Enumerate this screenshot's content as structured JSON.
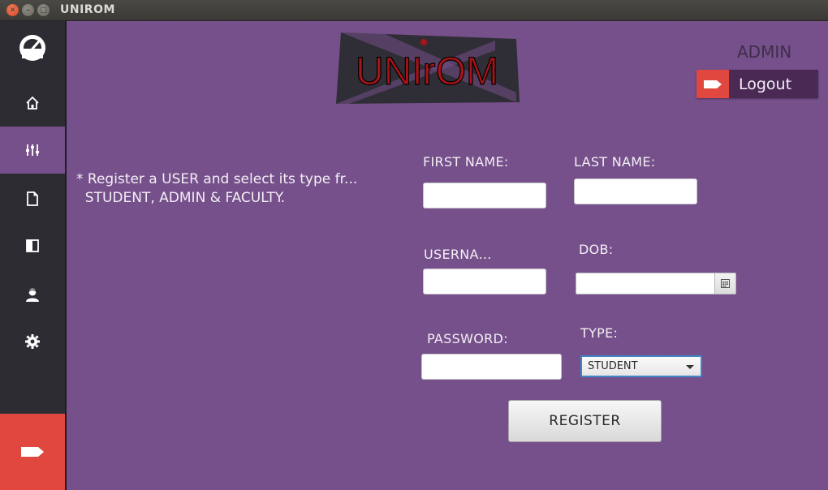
{
  "window": {
    "title": "UNIROM",
    "controls": [
      "close",
      "minimize",
      "maximize"
    ]
  },
  "sidebar": {
    "items": [
      {
        "icon": "dashboard-gauge-icon",
        "active": false
      },
      {
        "icon": "home-icon",
        "active": false
      },
      {
        "icon": "sliders-icon",
        "active": true
      },
      {
        "icon": "document-icon",
        "active": false
      },
      {
        "icon": "panel-icon",
        "active": false
      },
      {
        "icon": "user-icon",
        "active": false
      },
      {
        "icon": "gear-icon",
        "active": false
      }
    ],
    "logout_icon": "logout-tag-icon"
  },
  "header": {
    "logo_text": "UNIrOM",
    "role_label": "ADMIN",
    "logout_label": "Logout"
  },
  "note": {
    "text": "* Register a USER and select its type fr...\n  STUDENT, ADMIN & FACULTY."
  },
  "form": {
    "first_name_label": "FIRST NAME:",
    "first_name_value": "",
    "last_name_label": "LAST NAME:",
    "last_name_value": "",
    "username_label": "USERNA...",
    "username_value": "",
    "dob_label": "DOB:",
    "dob_value": "",
    "password_label": "PASSWORD:",
    "password_value": "",
    "type_label": "TYPE:",
    "type_value": "STUDENT",
    "register_label": "REGISTER"
  },
  "colors": {
    "main_bg": "#75508a",
    "sidebar_bg": "#2d2c33",
    "accent_red": "#e0483f",
    "logout_bg": "#4a2a55"
  }
}
